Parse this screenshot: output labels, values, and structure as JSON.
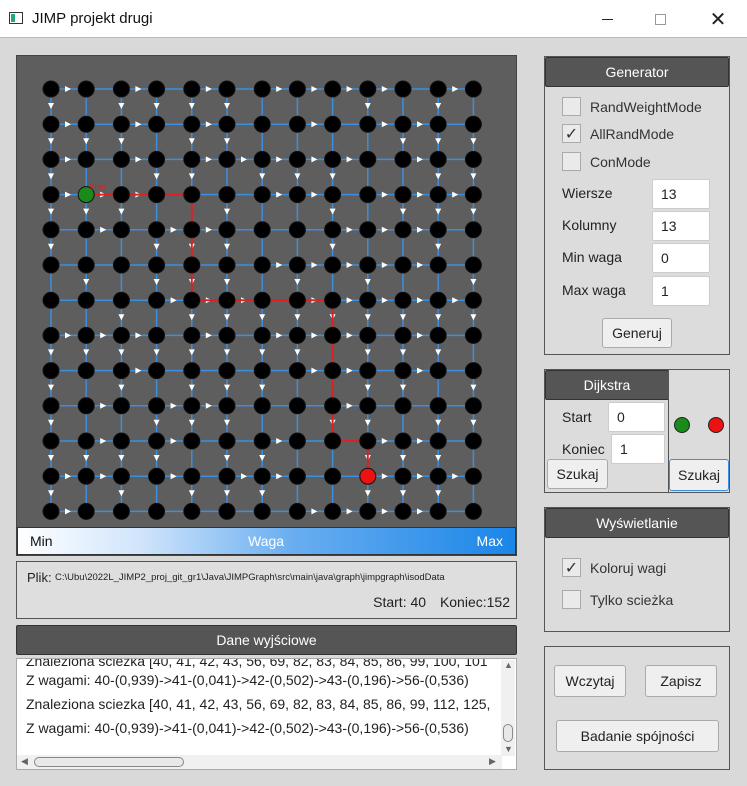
{
  "window": {
    "title": "JIMP projekt drugi",
    "min": "—",
    "max": "☐",
    "close": "✕"
  },
  "weight_bar": {
    "min": "Min",
    "label": "Waga",
    "max": "Max"
  },
  "graph": {
    "rows": 13,
    "cols": 13,
    "start_label": "Start",
    "colors": {
      "background": "#5e5e5e",
      "node": "#000000",
      "edge": "#3a8fe0",
      "arrow": "#ffffff",
      "path": "#e02020",
      "start": "#1a8a1a",
      "end": "#ee1111"
    }
  },
  "file": {
    "label": "Plik:",
    "path": "C:\\Ubu\\2022L_JIMP2_proj_git_gr1\\Java\\JIMPGraph\\src\\main\\java\\graph\\jimpgraph\\isodData",
    "start": "Start: 40",
    "koniec": "Koniec:152"
  },
  "output": {
    "header": "Dane wyjściowe",
    "lines": [
      "Znaleziona sciezka [40, 41, 42, 43, 56, 69, 82, 83, 84, 85, 86, 99, 100, 101",
      "Z wagami: 40-(0,939)->41-(0,041)->42-(0,502)->43-(0,196)->56-(0,536)",
      "Znaleziona sciezka [40, 41, 42, 43, 56, 69, 82, 83, 84, 85, 86, 99, 112, 125,",
      "Z wagami: 40-(0,939)->41-(0,041)->42-(0,502)->43-(0,196)->56-(0,536)"
    ]
  },
  "generator": {
    "header": "Generator",
    "checkboxes": [
      {
        "label": "RandWeightMode",
        "checked": false,
        "mark": ""
      },
      {
        "label": "AllRandMode",
        "checked": true,
        "mark": "✓"
      },
      {
        "label": "ConMode",
        "checked": false,
        "mark": ""
      }
    ],
    "fields": [
      {
        "label": "Wiersze",
        "value": "13"
      },
      {
        "label": "Kolumny",
        "value": "13"
      },
      {
        "label": "Min waga",
        "value": "0"
      },
      {
        "label": "Max waga",
        "value": "1"
      }
    ],
    "button": "Generuj"
  },
  "dijkstra": {
    "header": "Dijkstra",
    "start_label": "Start",
    "start_value": "0",
    "end_label": "Koniec",
    "end_value": "1",
    "search_button": "Szukaj",
    "search_button2": "Szukaj",
    "dot_colors": {
      "green": "#1a8a1a",
      "red": "#ee1111"
    }
  },
  "display": {
    "header": "Wyświetlanie",
    "checkboxes": [
      {
        "label": "Koloruj wagi",
        "checked": true,
        "mark": "✓"
      },
      {
        "label": "Tylko scieżka",
        "checked": false,
        "mark": ""
      }
    ]
  },
  "io": {
    "load": "Wczytaj",
    "save": "Zapisz",
    "connectivity": "Badanie spójności"
  }
}
